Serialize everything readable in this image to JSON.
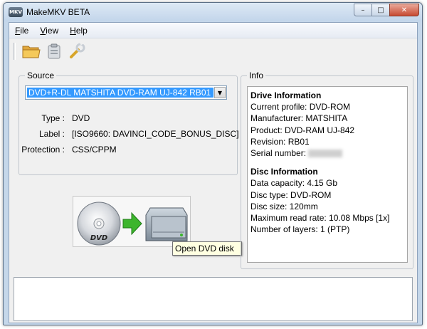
{
  "window": {
    "title": "MakeMKV BETA",
    "icon_text": "MKV",
    "minimize": "–",
    "maximize": "□",
    "close": "✕"
  },
  "menu": {
    "file": "File",
    "view": "View",
    "help": "Help"
  },
  "toolbar": {
    "icons": [
      "open-folder-icon",
      "clipboard-icon",
      "wrench-icon"
    ]
  },
  "source": {
    "group_label": "Source",
    "drive_selected": "DVD+R-DL MATSHITA DVD-RAM UJ-842 RB01",
    "type_label": "Type :",
    "type_value": "DVD",
    "label_label": "Label :",
    "label_value": "[ISO9660: DAVINCI_CODE_BONUS_DISC]",
    "protection_label": "Protection :",
    "protection_value": "CSS/CPPM"
  },
  "open_button": {
    "disc_text": "DVD",
    "tooltip": "Open DVD disk"
  },
  "info": {
    "group_label": "Info",
    "drive_header": "Drive Information",
    "current_profile": "Current profile: DVD-ROM",
    "manufacturer": "Manufacturer: MATSHITA",
    "product": "Product: DVD-RAM UJ-842",
    "revision": "Revision: RB01",
    "serial_label": "Serial number:",
    "disc_header": "Disc Information",
    "data_capacity": "Data capacity: 4.15 Gb",
    "disc_type": "Disc type: DVD-ROM",
    "disc_size": "Disc size: 120mm",
    "max_read_rate": "Maximum read rate: 10.08 Mbps [1x]",
    "layers": "Number of layers: 1 (PTP)"
  },
  "colors": {
    "selection": "#3399ff",
    "arrow_green": "#3cb52c",
    "close_red": "#c74a32"
  }
}
